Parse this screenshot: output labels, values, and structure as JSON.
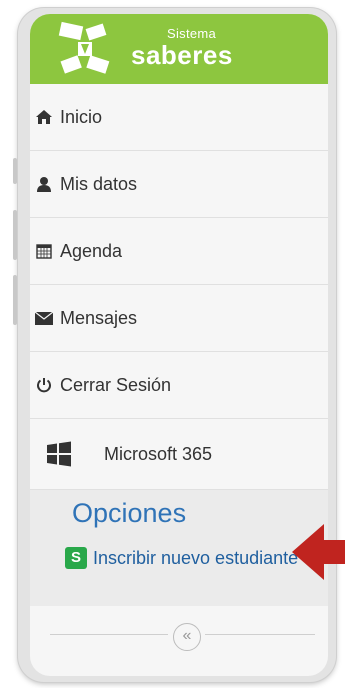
{
  "brand": {
    "small": "Sistema",
    "big": "saberes"
  },
  "menu": [
    {
      "label": "Inicio",
      "icon": "home-icon"
    },
    {
      "label": "Mis datos",
      "icon": "user-icon"
    },
    {
      "label": "Agenda",
      "icon": "calendar-icon"
    },
    {
      "label": "Mensajes",
      "icon": "envelope-icon"
    },
    {
      "label": "Cerrar Sesión",
      "icon": "power-icon"
    }
  ],
  "microsoft": {
    "label": "Microsoft 365",
    "icon": "windows-icon"
  },
  "options": {
    "title": "Opciones",
    "badge": "S",
    "enroll_label": "Inscribir nuevo estudiante"
  },
  "collapse": {
    "glyph": "«"
  },
  "colors": {
    "brand_green": "#8dc63f",
    "link_blue": "#1f5f9f",
    "arrow_red": "#c0241f"
  }
}
